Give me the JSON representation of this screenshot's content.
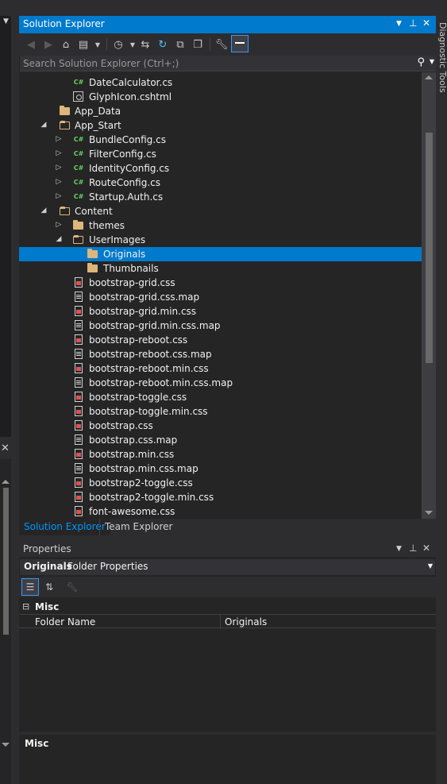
{
  "solution_explorer": {
    "title": "Solution Explorer",
    "search_placeholder": "Search Solution Explorer (Ctrl+;)",
    "items": [
      {
        "label": "DateCalculator.cs"
      },
      {
        "label": "GlyphIcon.cshtml"
      },
      {
        "label": "App_Data"
      },
      {
        "label": "App_Start"
      },
      {
        "label": "BundleConfig.cs"
      },
      {
        "label": "FilterConfig.cs"
      },
      {
        "label": "IdentityConfig.cs"
      },
      {
        "label": "RouteConfig.cs"
      },
      {
        "label": "Startup.Auth.cs"
      },
      {
        "label": "Content"
      },
      {
        "label": "themes"
      },
      {
        "label": "UserImages"
      },
      {
        "label": "Originals"
      },
      {
        "label": "Thumbnails"
      },
      {
        "label": "bootstrap-grid.css"
      },
      {
        "label": "bootstrap-grid.css.map"
      },
      {
        "label": "bootstrap-grid.min.css"
      },
      {
        "label": "bootstrap-grid.min.css.map"
      },
      {
        "label": "bootstrap-reboot.css"
      },
      {
        "label": "bootstrap-reboot.css.map"
      },
      {
        "label": "bootstrap-reboot.min.css"
      },
      {
        "label": "bootstrap-reboot.min.css.map"
      },
      {
        "label": "bootstrap-toggle.css"
      },
      {
        "label": "bootstrap-toggle.min.css"
      },
      {
        "label": "bootstrap.css"
      },
      {
        "label": "bootstrap.css.map"
      },
      {
        "label": "bootstrap.min.css"
      },
      {
        "label": "bootstrap.min.css.map"
      },
      {
        "label": "bootstrap2-toggle.css"
      },
      {
        "label": "bootstrap2-toggle.min.css"
      },
      {
        "label": "font-awesome.css"
      }
    ],
    "cs_badge": "C#",
    "tabs": [
      {
        "label": "Solution Explorer"
      },
      {
        "label": "Team Explorer"
      }
    ]
  },
  "properties": {
    "title": "Properties",
    "object_name": "Originals",
    "object_type": "Folder Properties",
    "category": "Misc",
    "category_toggle": "⊟",
    "rows": [
      {
        "name": "Folder Name",
        "value": "Originals"
      }
    ],
    "description_title": "Misc"
  },
  "right_tab": "Diagnostic Tools",
  "colors": {
    "accent": "#007acc",
    "background": "#252526",
    "chrome": "#2d2d30"
  }
}
